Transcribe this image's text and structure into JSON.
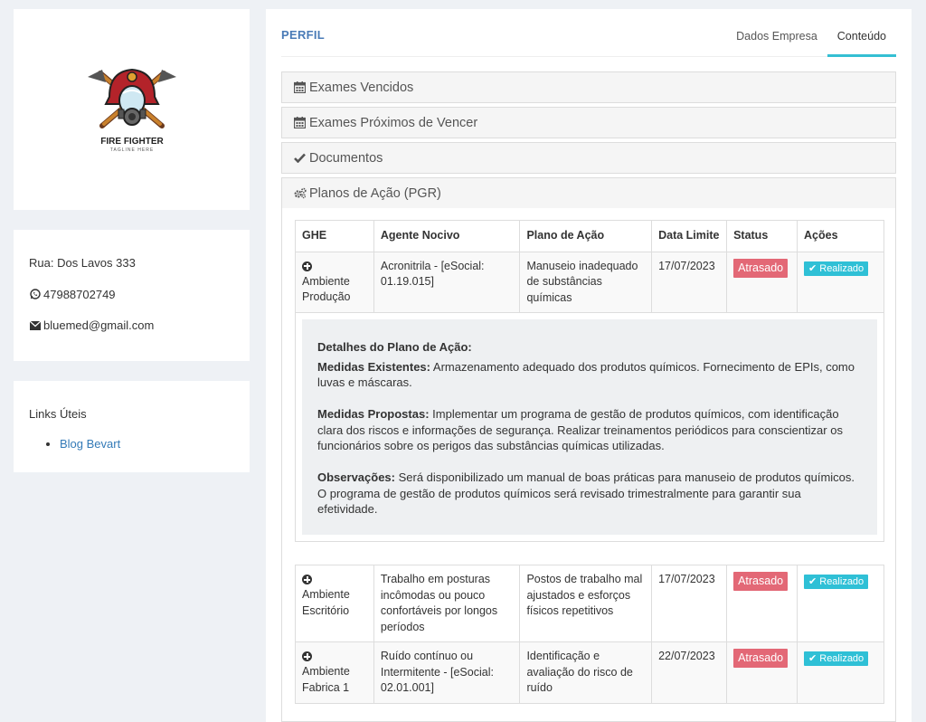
{
  "logo": {
    "title": "FIRE FIGHTER",
    "tagline": "TAGLINE HERE"
  },
  "contact": {
    "address": "Rua: Dos Lavos 333",
    "phone": "47988702749",
    "email": "bluemed@gmail.com",
    "icons": [
      "whatsapp-icon",
      "envelope-icon"
    ]
  },
  "links": {
    "title": "Links Úteis",
    "items": [
      {
        "label": "Blog Bevart"
      }
    ]
  },
  "header": {
    "title": "PERFIL",
    "tabs": [
      {
        "label": "Dados Empresa",
        "active": false
      },
      {
        "label": "Conteúdo",
        "active": true
      }
    ],
    "accent": "#34bfd3"
  },
  "accordion": [
    {
      "label": "Exames Vencidos",
      "icon": "calendar-icon"
    },
    {
      "label": "Exames Próximos de Vencer",
      "icon": "calendar-icon"
    },
    {
      "label": "Documentos",
      "icon": "check-icon"
    },
    {
      "label": "Planos de Ação (PGR)",
      "icon": "gears-icon"
    }
  ],
  "table": {
    "headers": [
      "GHE",
      "Agente Nocivo",
      "Plano de Ação",
      "Data Limite",
      "Status",
      "Ações"
    ],
    "rows": [
      {
        "ghe": "Ambiente Produção",
        "agente": "Acronitrila - [eSocial: 01.19.015]",
        "plano": "Manuseio inadequado de substâncias químicas",
        "data": "17/07/2023",
        "status": "Atrasado",
        "acao": "Realizado"
      },
      {
        "ghe": "Ambiente Escritório",
        "agente": "Trabalho em posturas incômodas ou pouco confortáveis por longos períodos",
        "plano": "Postos de trabalho mal ajustados e esforços físicos repetitivos",
        "data": "17/07/2023",
        "status": "Atrasado",
        "acao": "Realizado"
      },
      {
        "ghe": "Ambiente Fabrica 1",
        "agente": "Ruído contínuo ou Intermitente - [eSocial: 02.01.001]",
        "plano": "Identificação e avaliação do risco de ruído",
        "data": "22/07/2023",
        "status": "Atrasado",
        "acao": "Realizado"
      }
    ],
    "status_color": "#e36876",
    "action_color": "#2fc0d6"
  },
  "details": {
    "title": "Detalhes do Plano de Ação:",
    "existentes_label": "Medidas Existentes:",
    "existentes_text": " Armazenamento adequado dos produtos químicos. Fornecimento de EPIs, como luvas e máscaras.",
    "propostas_label": "Medidas Propostas:",
    "propostas_text": " Implementar um programa de gestão de produtos químicos, com identificação clara dos riscos e informações de segurança. Realizar treinamentos periódicos para conscientizar os funcionários sobre os perigos das substâncias químicas utilizadas.",
    "observacoes_label": "Observações:",
    "observacoes_text": " Será disponibilizado um manual de boas práticas para manuseio de produtos químicos. O programa de gestão de produtos químicos será revisado trimestralmente para garantir sua efetividade."
  }
}
